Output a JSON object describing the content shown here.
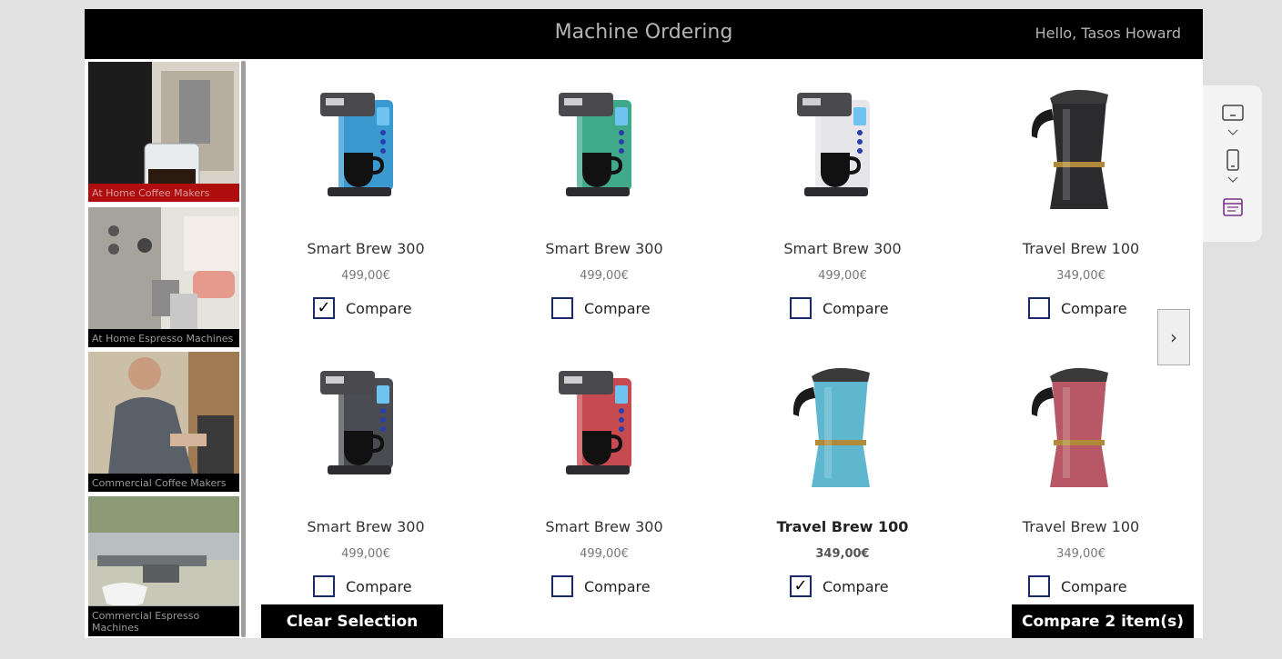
{
  "header": {
    "title": "Machine Ordering",
    "greeting": "Hello, Tasos Howard"
  },
  "sidebar": {
    "categories": [
      {
        "label": "At Home Coffee Makers",
        "selected": true
      },
      {
        "label": "At Home Espresso Machines",
        "selected": false
      },
      {
        "label": "Commercial Coffee Makers",
        "selected": false
      },
      {
        "label": "Commercial Espresso Machines",
        "selected": false
      }
    ]
  },
  "products": [
    {
      "name": "Smart Brew 300",
      "price": "499,00€",
      "compare_label": "Compare",
      "checked": true,
      "color": "#3a9ad0",
      "kind": "brewer"
    },
    {
      "name": "Smart Brew 300",
      "price": "499,00€",
      "compare_label": "Compare",
      "checked": false,
      "color": "#3fa98a",
      "kind": "brewer"
    },
    {
      "name": "Smart Brew 300",
      "price": "499,00€",
      "compare_label": "Compare",
      "checked": false,
      "color": "#e6e6ea",
      "kind": "brewer"
    },
    {
      "name": "Travel Brew 100",
      "price": "349,00€",
      "compare_label": "Compare",
      "checked": false,
      "color": "#2b2b2e",
      "kind": "moka"
    },
    {
      "name": "Smart Brew 300",
      "price": "499,00€",
      "compare_label": "Compare",
      "checked": false,
      "color": "#4a4c52",
      "kind": "brewer"
    },
    {
      "name": "Smart Brew 300",
      "price": "499,00€",
      "compare_label": "Compare",
      "checked": false,
      "color": "#c64a50",
      "kind": "brewer"
    },
    {
      "name": "Travel Brew 100",
      "price": "349,00€",
      "compare_label": "Compare",
      "checked": true,
      "color": "#5fb6cf",
      "kind": "moka"
    },
    {
      "name": "Travel Brew 100",
      "price": "349,00€",
      "compare_label": "Compare",
      "checked": false,
      "color": "#b85866",
      "kind": "moka"
    }
  ],
  "actions": {
    "clear_label": "Clear Selection",
    "compare_label": "Compare 2 item(s)"
  },
  "icons": {
    "next": "chevron-right-icon",
    "tablet": "tablet-icon",
    "phone": "phone-icon",
    "web": "web-layout-icon"
  }
}
